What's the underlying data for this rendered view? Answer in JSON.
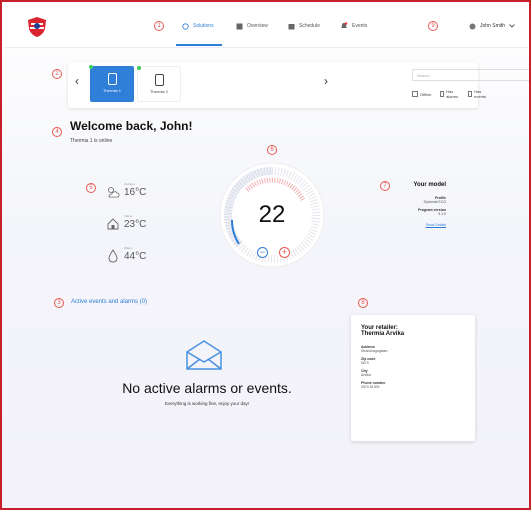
{
  "colors": {
    "accent": "#2f7fd8",
    "annotation": "#ea5a52",
    "online": "#3fcc5a",
    "frame": "#c8202a"
  },
  "header": {
    "logo": "shield-logo",
    "nav": [
      {
        "label": "Solutions",
        "icon": "thermostat-icon",
        "active": true
      },
      {
        "label": "Overview",
        "icon": "grid-icon",
        "active": false
      },
      {
        "label": "Schedule",
        "icon": "calendar-icon",
        "active": false
      },
      {
        "label": "Events",
        "icon": "bell-icon",
        "active": false
      }
    ],
    "user": "John Smith"
  },
  "annotations": [
    "1",
    "2",
    "3",
    "4",
    "5",
    "6",
    "7",
    "8",
    "9"
  ],
  "selector": {
    "devices": [
      {
        "label": "Thermia 1",
        "active": true,
        "online": true
      },
      {
        "label": "Thermia 2",
        "active": false,
        "online": true
      }
    ],
    "search_placeholder": "Search",
    "filters": [
      "Offline",
      "Has alarms",
      "Has events"
    ]
  },
  "welcome": {
    "title": "Welcome back, John!",
    "subtitle": "Thermia 1 is online"
  },
  "weather": [
    {
      "label": "Outdoor",
      "value": "16°C",
      "icon": "partly-cloudy-icon"
    },
    {
      "label": "Indoor",
      "value": "23°C",
      "icon": "house-icon"
    },
    {
      "label": "Water",
      "value": "44°C",
      "icon": "water-drop-icon"
    }
  ],
  "dial": {
    "value": "22",
    "minus": "−",
    "plus": "+"
  },
  "model": {
    "title": "Your model",
    "profile_label": "Profile",
    "profile_value": "Diplomat ECO",
    "program_label": "Program version",
    "program_value": "9.1.0",
    "link": "Show Details"
  },
  "events": {
    "title": "Active events and alarms (0)",
    "empty_title": "No active alarms or events.",
    "empty_sub": "Everything is working fine, enjoy your day!"
  },
  "retailer": {
    "title1": "Your retailer:",
    "title2": "Thermia Arvika",
    "address_label": "Address",
    "address_value": "Strandvagsgatan",
    "zip_label": "Zip code",
    "zip_value": "6670",
    "city_label": "City",
    "city_value": "Arvika",
    "phone_label": "Phone number",
    "phone_value": "0570 81300"
  }
}
